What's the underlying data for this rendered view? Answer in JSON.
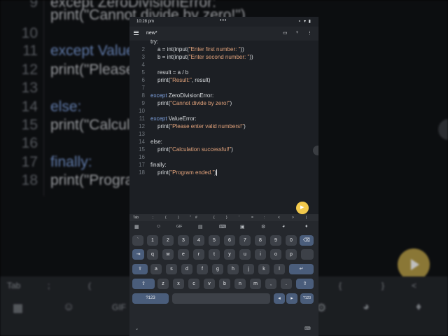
{
  "background": {
    "lines": [
      {
        "num": "9",
        "code": "except ZeroDivisionError:"
      },
      {
        "num": "",
        "code": "    print(\"Cannot divide by zero!\")"
      },
      {
        "num": "10",
        "code": ""
      },
      {
        "num": "11",
        "code": "except ValueError:"
      },
      {
        "num": "12",
        "code": "    print(\"Please enter valid numbers!\")"
      },
      {
        "num": "13",
        "code": ""
      },
      {
        "num": "14",
        "code": "else:"
      },
      {
        "num": "15",
        "code": "    print(\"Calculation successful!\")"
      },
      {
        "num": "16",
        "code": ""
      },
      {
        "num": "17",
        "code": "finally:"
      },
      {
        "num": "18",
        "code": "    print(\"Program ended.\")"
      }
    ]
  },
  "status_bar": {
    "time": "10:28 pm",
    "dots": "•••",
    "icons": "⚬ ▾ ▮"
  },
  "app": {
    "title": "new*"
  },
  "editor": {
    "lines": [
      {
        "num": "",
        "code": "try:"
      },
      {
        "num": "2",
        "code": "    a = int(input(\"Enter first number: \"))"
      },
      {
        "num": "3",
        "code": "    b = int(input(\"Enter second number: \"))"
      },
      {
        "num": "4",
        "code": ""
      },
      {
        "num": "5",
        "code": "    result = a / b"
      },
      {
        "num": "6",
        "code": "    print(\"Result:\", result)"
      },
      {
        "num": "7",
        "code": ""
      },
      {
        "num": "8",
        "code": "except ZeroDivisionError:"
      },
      {
        "num": "9",
        "code": "    print(\"Cannot divide by zero!\")"
      },
      {
        "num": "10",
        "code": ""
      },
      {
        "num": "11",
        "code": "except ValueError:"
      },
      {
        "num": "12",
        "code": "    print(\"Please enter valid numbers!\")"
      },
      {
        "num": "13",
        "code": ""
      },
      {
        "num": "14",
        "code": "else:"
      },
      {
        "num": "15",
        "code": "    print(\"Calculation successful!\")"
      },
      {
        "num": "16",
        "code": ""
      },
      {
        "num": "17",
        "code": "finally:"
      },
      {
        "num": "18",
        "code": "    print(\"Program ended.\")"
      }
    ]
  },
  "symbol_bar": [
    "Tab",
    ";",
    "(",
    ")",
    "\"",
    "#",
    "{",
    "}",
    "'",
    "=",
    ":",
    "<",
    ">",
    "|"
  ],
  "keyboard": {
    "number_row": [
      "`",
      "1",
      "2",
      "3",
      "4",
      "5",
      "6",
      "7",
      "8",
      "9",
      "0"
    ],
    "row1": [
      "q",
      "w",
      "e",
      "r",
      "t",
      "y",
      "u",
      "i",
      "o",
      "p"
    ],
    "row2": [
      "a",
      "s",
      "d",
      "f",
      "g",
      "h",
      "j",
      "k",
      "l"
    ],
    "row3": [
      "z",
      "x",
      "c",
      "v",
      "b",
      "n",
      "m",
      ",",
      " ."
    ],
    "symbols_key": "?123",
    "tools": [
      "GIF"
    ]
  },
  "bg_bar": {
    "tab": "Tab",
    "symbols": [
      ";",
      "(",
      ")",
      "\"",
      "#",
      "{",
      "}",
      "<"
    ],
    "gif": "GIF"
  },
  "colors": {
    "accent": "#f2c94c",
    "keyword": "#7fa2e0",
    "string": "#e3a37b",
    "editor_bg": "#1c1f24"
  },
  "icons": [
    "menu-icon",
    "folder-icon",
    "bulb-icon",
    "more-vert-icon",
    "play-icon",
    "backspace-icon",
    "tab-icon",
    "enter-icon",
    "shift-icon",
    "mic-icon",
    "settings-icon",
    "palette-icon",
    "clipboard-icon",
    "emoji-icon"
  ]
}
